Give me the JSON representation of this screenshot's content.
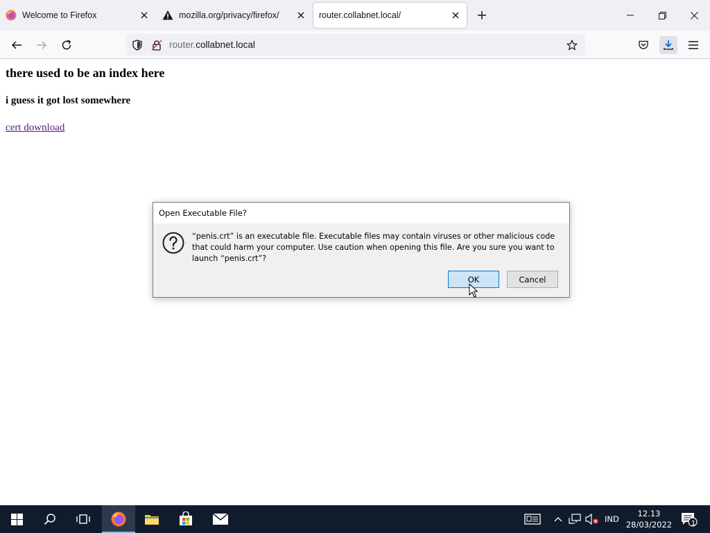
{
  "browser": {
    "tabs": [
      {
        "title": "Welcome to Firefox",
        "icon": "firefox-logo-icon",
        "active": false
      },
      {
        "title": "mozilla.org/privacy/firefox/",
        "icon": "warning-icon",
        "active": false
      },
      {
        "title": "router.collabnet.local/",
        "icon": "none",
        "active": true
      }
    ],
    "url": {
      "prefix": "router.",
      "host": "collabnet.local"
    }
  },
  "page": {
    "heading": "there used to be an index here",
    "subheading": "i guess it got lost somewhere",
    "link": "cert download"
  },
  "dialog": {
    "title": "Open Executable File?",
    "message": "“penis.crt” is an executable file. Executable files may contain viruses or other malicious code that could harm your computer. Use caution when opening this file. Are you sure you want to launch “penis.crt”?",
    "ok_label": "OK",
    "cancel_label": "Cancel"
  },
  "taskbar": {
    "language": "IND",
    "time": "12.13",
    "date": "28/03/2022",
    "notification_count": "1"
  },
  "colors": {
    "accent": "#0078d7",
    "taskbar": "#101c2b",
    "link": "#551a8b",
    "firefox_orange": "#ff7139"
  }
}
